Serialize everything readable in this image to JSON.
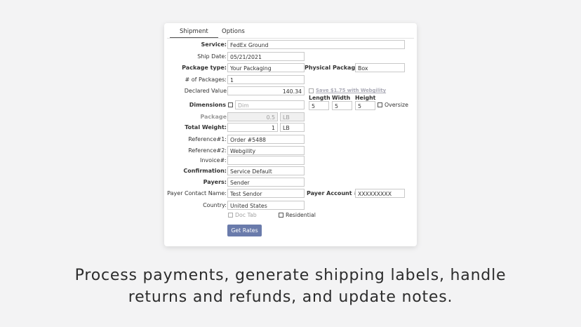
{
  "tabs": {
    "shipment": "Shipment",
    "options": "Options"
  },
  "labels": {
    "service": "Service:",
    "ship_date": "Ship Date:",
    "package_type": "Package type:",
    "physical_package": "Physical Package:",
    "num_packages": "# of Packages:",
    "declared_value": "Declared Value",
    "save_link": "Save $1.75 with Webgility",
    "dimensions": "Dimensions",
    "length": "Length",
    "width": "Width",
    "height": "Height",
    "oversize": "Oversize",
    "package": "Package",
    "total_weight": "Total Weight:",
    "reference1": "Reference#1:",
    "reference2": "Reference#2:",
    "invoice": "Invoice#:",
    "confirmation": "Confirmation:",
    "payers": "Payers:",
    "payer_contact": "Payer Contact Name:",
    "payer_account": "Payer Account #:",
    "country": "Country:",
    "doc_tab": "Doc Tab",
    "residential": "Residential"
  },
  "values": {
    "service": "FedEx Ground",
    "ship_date": "05/21/2021",
    "package_type": "Your Packaging",
    "physical_package": "Box",
    "num_packages": "1",
    "declared_value": "140.34",
    "dim_placeholder": "Dim",
    "length": "5",
    "width": "5",
    "height": "5",
    "package_weight": "0.5",
    "package_unit": "LB",
    "total_weight": "1",
    "total_unit": "LB",
    "reference1": "Order #5488",
    "reference2": "Webgility",
    "invoice": "",
    "confirmation": "Service Default",
    "payers": "Sender",
    "payer_contact": "Test Sendor",
    "payer_account": "XXXXXXXXX",
    "country": "United States"
  },
  "buttons": {
    "get_rates": "Get Rates"
  },
  "caption": {
    "line1": "Process payments, generate shipping labels, handle",
    "line2": "returns and refunds, and update notes."
  }
}
